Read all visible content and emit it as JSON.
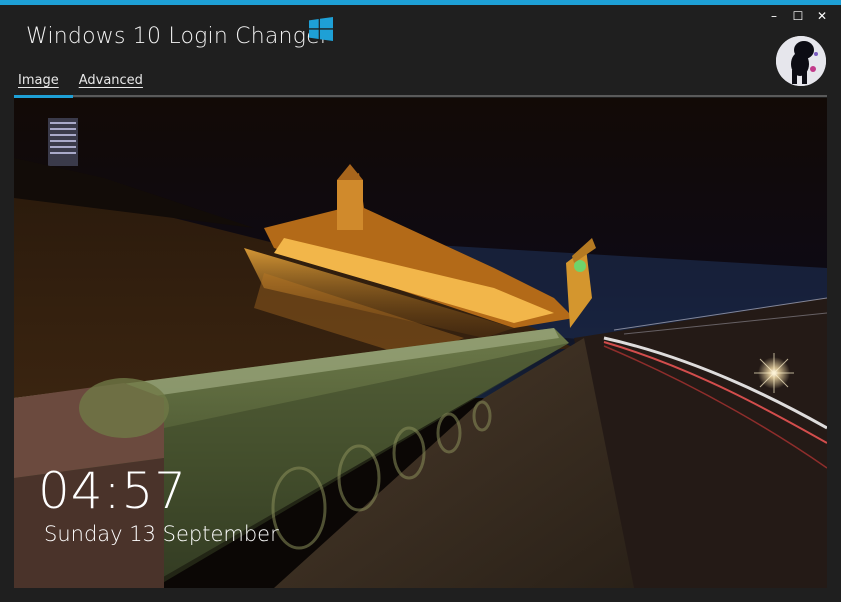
{
  "window": {
    "title": "Windows 10 Login Changer",
    "accent_color": "#1ea0d6",
    "controls": {
      "minimize": "–",
      "maximize": "☐",
      "close": "✕"
    }
  },
  "tabs": [
    {
      "label": "Image",
      "active": true
    },
    {
      "label": "Advanced",
      "active": false
    }
  ],
  "avatar": {
    "icon": "user-avatar-dog"
  },
  "lockscreen": {
    "time": "04:57",
    "date": "Sunday 13 September"
  }
}
